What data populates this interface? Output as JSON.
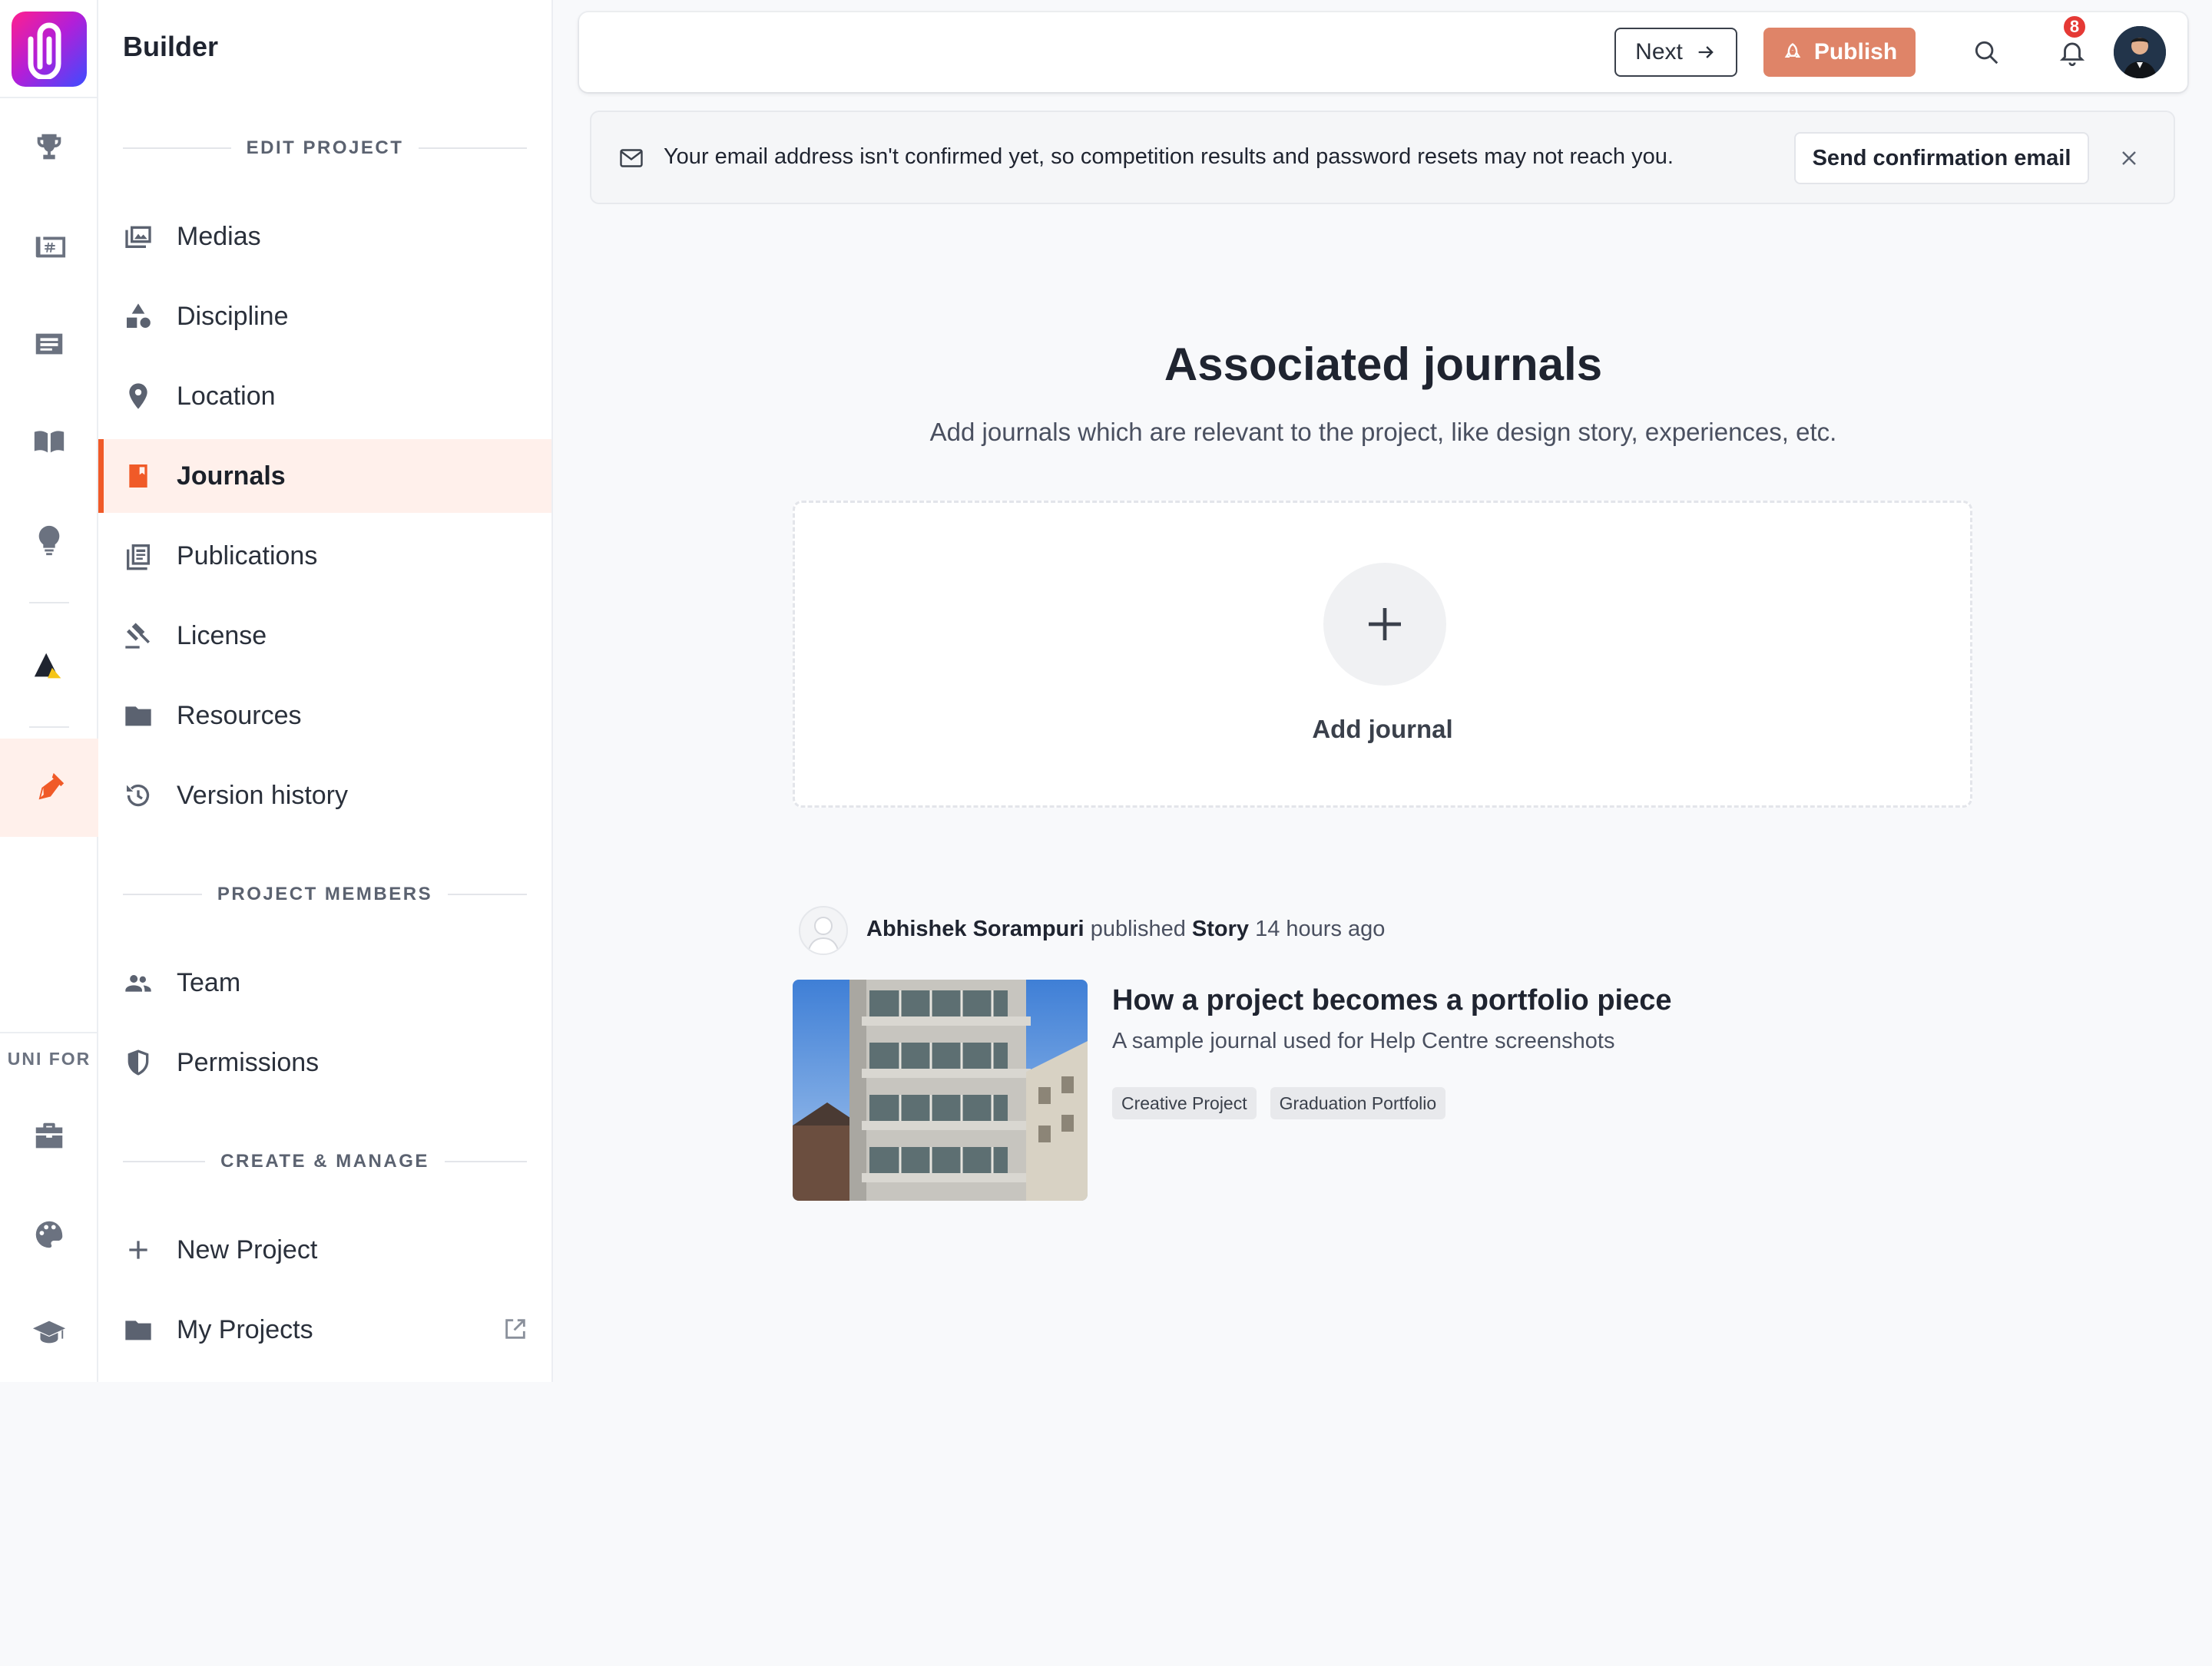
{
  "app": {
    "name": "Builder",
    "accent_color": "#f05a28"
  },
  "rail": {
    "items": [
      {
        "icon": "trophy-icon"
      },
      {
        "icon": "hashtag-board-icon"
      },
      {
        "icon": "article-icon"
      },
      {
        "icon": "open-book-icon"
      },
      {
        "icon": "lightbulb-icon"
      },
      {
        "icon": "triangle-logo-icon"
      },
      {
        "icon": "pen-nib-icon",
        "active": true
      }
    ],
    "section_caption": "UNI FOR",
    "bottom_items": [
      {
        "icon": "briefcase-icon"
      },
      {
        "icon": "palette-icon"
      },
      {
        "icon": "graduation-cap-icon"
      }
    ]
  },
  "sidebar": {
    "title": "Builder",
    "sections": {
      "edit_project": "EDIT PROJECT",
      "project_members": "PROJECT MEMBERS",
      "create_manage": "CREATE & MANAGE"
    },
    "edit_items": [
      {
        "label": "Medias",
        "icon": "images-icon"
      },
      {
        "label": "Discipline",
        "icon": "shapes-icon"
      },
      {
        "label": "Location",
        "icon": "map-pin-icon"
      },
      {
        "label": "Journals",
        "icon": "journal-icon",
        "active": true
      },
      {
        "label": "Publications",
        "icon": "publications-icon"
      },
      {
        "label": "License",
        "icon": "gavel-icon"
      },
      {
        "label": "Resources",
        "icon": "folder-icon"
      },
      {
        "label": "Version history",
        "icon": "history-icon"
      }
    ],
    "member_items": [
      {
        "label": "Team",
        "icon": "people-icon"
      },
      {
        "label": "Permissions",
        "icon": "shield-icon"
      }
    ],
    "manage_items": [
      {
        "label": "New Project",
        "icon": "plus-icon"
      },
      {
        "label": "My Projects",
        "icon": "folder-icon",
        "external": "external-link-icon"
      }
    ]
  },
  "topbar": {
    "next_label": "Next",
    "publish_label": "Publish",
    "publish_color": "#df8468",
    "notification_count": "8"
  },
  "alert": {
    "message": "Your email address isn't confirmed yet, so competition results and password resets may not reach you.",
    "action_label": "Send confirmation email"
  },
  "main": {
    "title": "Associated journals",
    "subtitle": "Add journals which are relevant to the project, like design story, experiences, etc.",
    "add_label": "Add journal"
  },
  "activity": {
    "author": "Abhishek Sorampuri",
    "verb": "published",
    "type": "Story",
    "time": "14 hours ago",
    "journal": {
      "title": "How a project becomes a portfolio piece",
      "description": "A sample journal used for Help Centre screenshots",
      "tags": [
        "Creative Project",
        "Graduation Portfolio"
      ]
    }
  }
}
